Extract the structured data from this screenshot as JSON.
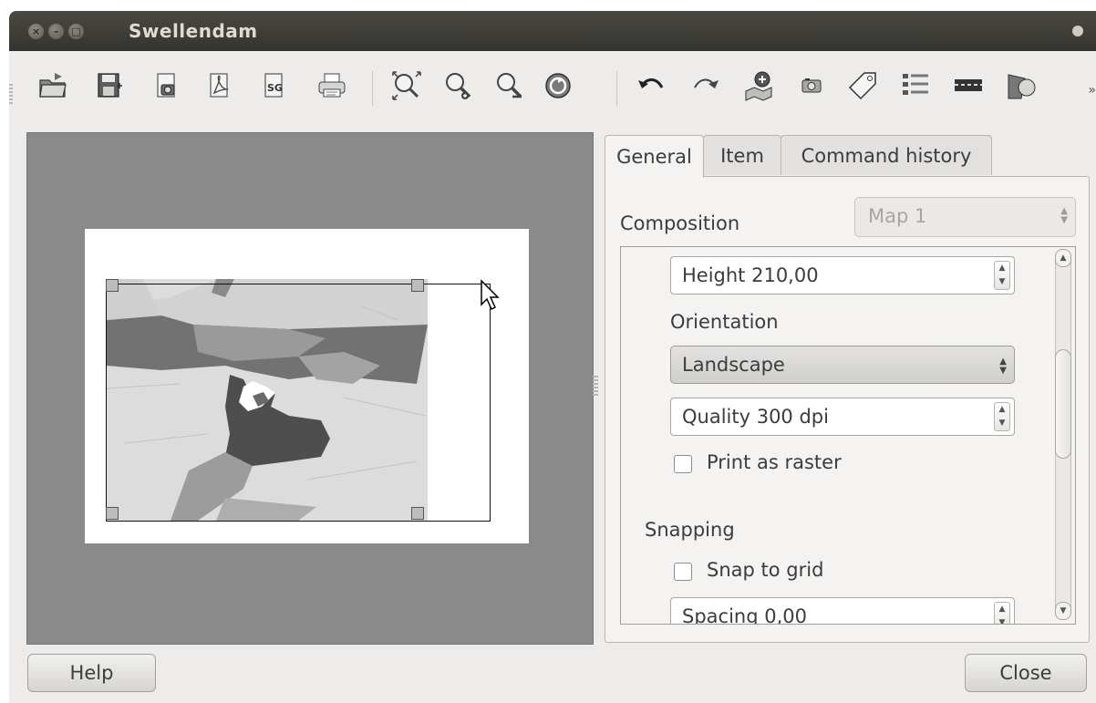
{
  "window": {
    "title": "Swellendam"
  },
  "toolbar": {
    "icons": [
      "load-composer-icon",
      "save-template-icon",
      "export-image-icon",
      "export-pdf-icon",
      "export-svg-icon",
      "print-icon",
      "zoom-full-icon",
      "zoom-in-icon",
      "zoom-out-icon",
      "refresh-icon",
      "undo-icon",
      "redo-icon",
      "add-map-icon",
      "add-image-icon",
      "add-label-icon",
      "add-legend-icon",
      "add-scalebar-icon",
      "add-shape-icon"
    ],
    "overflow": "»"
  },
  "tabs": [
    {
      "label": "General"
    },
    {
      "label": "Item"
    },
    {
      "label": "Command history"
    }
  ],
  "general": {
    "composition_label": "Composition",
    "composition_value": "Map 1",
    "height": "Height 210,00",
    "orientation_label": "Orientation",
    "orientation_value": "Landscape",
    "quality": "Quality 300 dpi",
    "print_as_raster": {
      "label": "Print as raster",
      "checked": false
    },
    "snapping_label": "Snapping",
    "snap_to_grid": {
      "label": "Snap to grid",
      "checked": false
    },
    "spacing": "Spacing 0,00"
  },
  "footer": {
    "help_label": "Help",
    "close_label": "Close"
  }
}
